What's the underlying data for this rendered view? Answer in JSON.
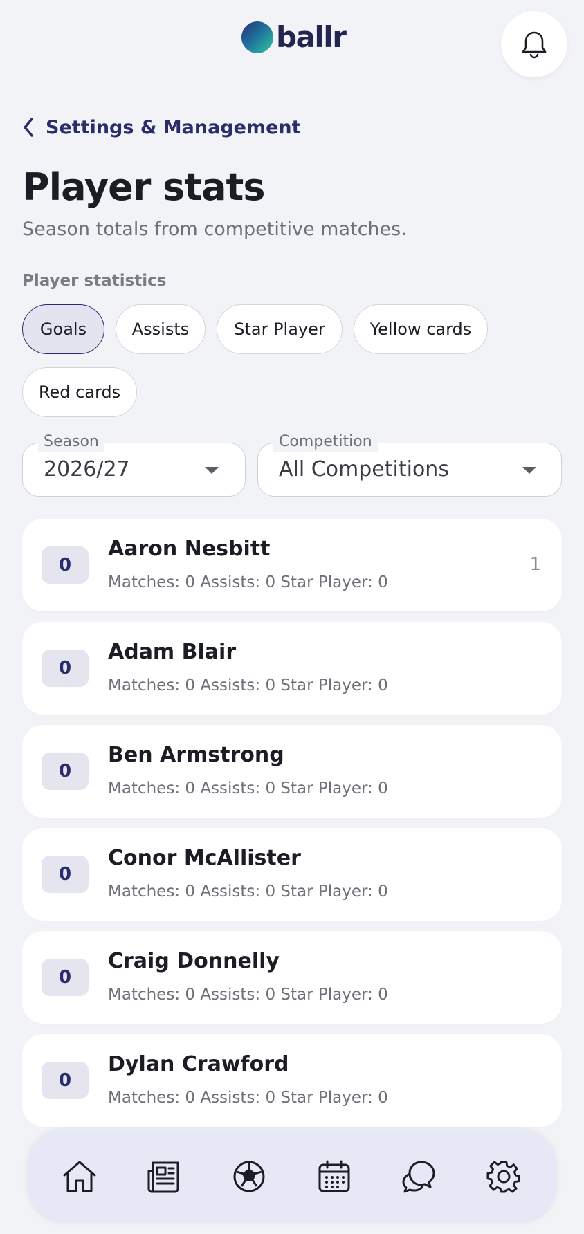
{
  "header": {
    "logo_text": "ballr",
    "notifications_icon": "bell-icon"
  },
  "nav_back": {
    "icon": "chevron-left-icon",
    "label": "Settings & Management"
  },
  "page": {
    "title": "Player stats",
    "subtitle": "Season totals from competitive matches."
  },
  "statistics": {
    "label": "Player statistics",
    "chips": [
      {
        "label": "Goals",
        "active": true
      },
      {
        "label": "Assists",
        "active": false
      },
      {
        "label": "Star Player",
        "active": false
      },
      {
        "label": "Yellow cards",
        "active": false
      },
      {
        "label": "Red cards",
        "active": false
      }
    ]
  },
  "filters": {
    "season": {
      "label": "Season",
      "value": "2026/27"
    },
    "competition": {
      "label": "Competition",
      "value": "All Competitions"
    }
  },
  "players": [
    {
      "count": "0",
      "name": "Aaron Nesbitt",
      "stats": "Matches: 0 Assists: 0 Star Player: 0",
      "rank": "1"
    },
    {
      "count": "0",
      "name": "Adam Blair",
      "stats": "Matches: 0 Assists: 0 Star Player: 0",
      "rank": ""
    },
    {
      "count": "0",
      "name": "Ben Armstrong",
      "stats": "Matches: 0 Assists: 0 Star Player: 0",
      "rank": ""
    },
    {
      "count": "0",
      "name": "Conor McAllister",
      "stats": "Matches: 0 Assists: 0 Star Player: 0",
      "rank": ""
    },
    {
      "count": "0",
      "name": "Craig Donnelly",
      "stats": "Matches: 0 Assists: 0 Star Player: 0",
      "rank": ""
    },
    {
      "count": "0",
      "name": "Dylan Crawford",
      "stats": "Matches: 0 Assists: 0 Star Player: 0",
      "rank": ""
    }
  ],
  "bottom_nav": [
    {
      "icon": "home-icon"
    },
    {
      "icon": "news-icon"
    },
    {
      "icon": "football-icon"
    },
    {
      "icon": "calendar-icon"
    },
    {
      "icon": "chat-icon"
    },
    {
      "icon": "settings-gear-icon"
    }
  ],
  "colors": {
    "background": "#f2f3f7",
    "accent": "#2b2c6b",
    "card": "#ffffff",
    "nav_background": "#e7e8f6"
  }
}
